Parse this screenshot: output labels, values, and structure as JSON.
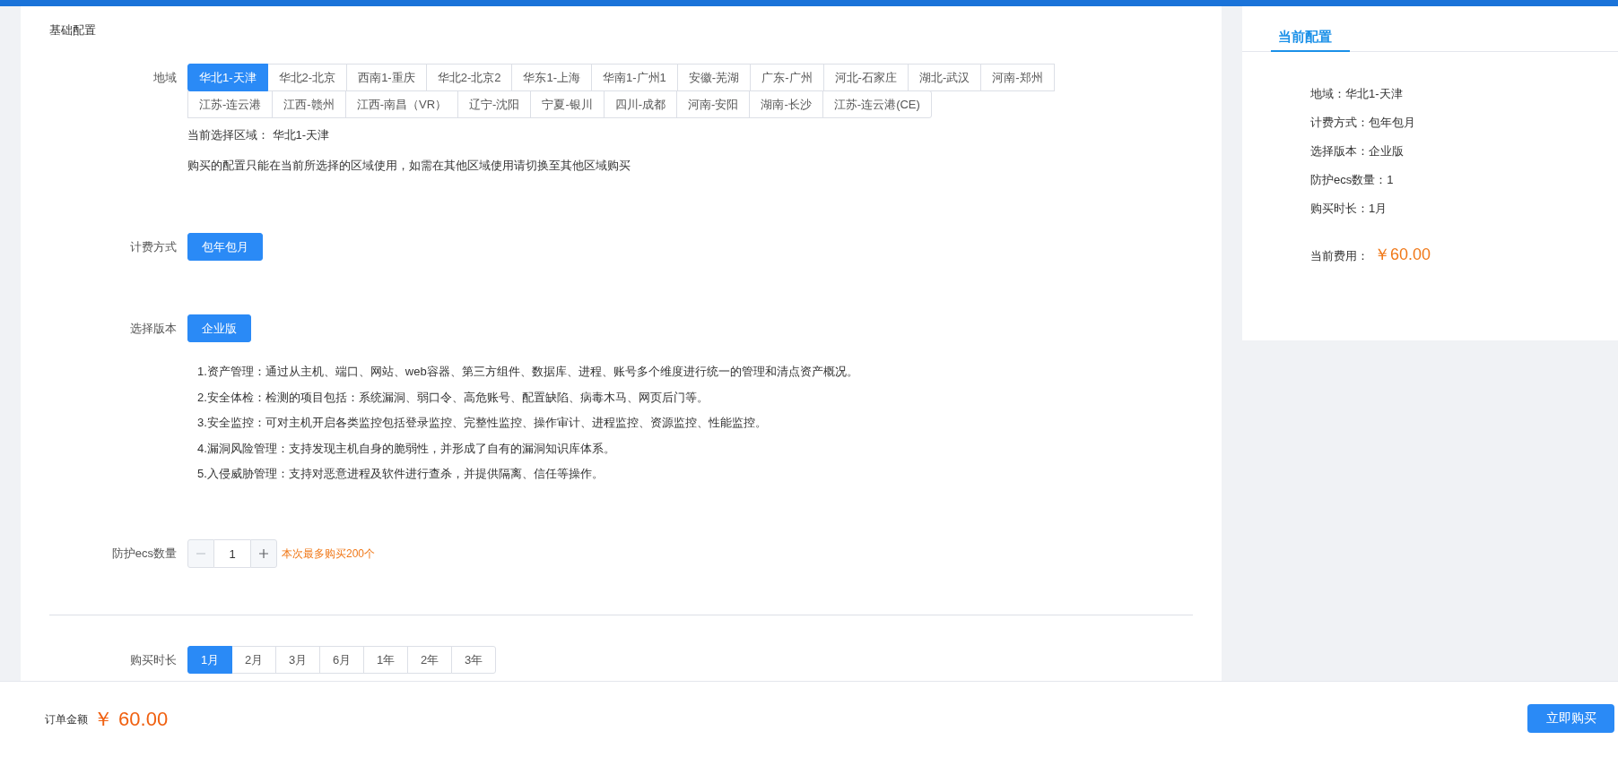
{
  "page_title": "基础配置",
  "region": {
    "label": "地域",
    "rows": [
      [
        {
          "label": "华北1-天津",
          "selected": true
        },
        {
          "label": "华北2-北京",
          "selected": false
        },
        {
          "label": "西南1-重庆",
          "selected": false
        },
        {
          "label": "华北2-北京2",
          "selected": false
        },
        {
          "label": "华东1-上海",
          "selected": false
        },
        {
          "label": "华南1-广州1",
          "selected": false
        },
        {
          "label": "安徽-芜湖",
          "selected": false
        },
        {
          "label": "广东-广州",
          "selected": false
        },
        {
          "label": "河北-石家庄",
          "selected": false
        },
        {
          "label": "湖北-武汉",
          "selected": false
        },
        {
          "label": "河南-郑州",
          "selected": false
        }
      ],
      [
        {
          "label": "江苏-连云港",
          "selected": false
        },
        {
          "label": "江西-赣州",
          "selected": false
        },
        {
          "label": "江西-南昌（VR）",
          "selected": false
        },
        {
          "label": "辽宁-沈阳",
          "selected": false
        },
        {
          "label": "宁夏-银川",
          "selected": false
        },
        {
          "label": "四川-成都",
          "selected": false
        },
        {
          "label": "河南-安阳",
          "selected": false
        },
        {
          "label": "湖南-长沙",
          "selected": false
        },
        {
          "label": "江苏-连云港(CE)",
          "selected": false
        }
      ]
    ],
    "current_label": "当前选择区域：",
    "current_value": "华北1-天津",
    "note": "购买的配置只能在当前所选择的区域使用，如需在其他区域使用请切换至其他区域购买"
  },
  "billing": {
    "label": "计费方式",
    "options": [
      {
        "label": "包年包月",
        "selected": true
      }
    ]
  },
  "edition": {
    "label": "选择版本",
    "options": [
      {
        "label": "企业版",
        "selected": true
      }
    ],
    "features": [
      "1.资产管理：通过从主机、端口、网站、web容器、第三方组件、数据库、进程、账号多个维度进行统一的管理和清点资产概况。",
      "2.安全体检：检测的项目包括：系统漏洞、弱口令、高危账号、配置缺陷、病毒木马、网页后门等。",
      "3.安全监控：可对主机开启各类监控包括登录监控、完整性监控、操作审计、进程监控、资源监控、性能监控。",
      "4.漏洞风险管理：支持发现主机自身的脆弱性，并形成了自有的漏洞知识库体系。",
      "5.入侵威胁管理：支持对恶意进程及软件进行查杀，并提供隔离、信任等操作。"
    ]
  },
  "quantity": {
    "label": "防护ecs数量",
    "value": "1",
    "minus_disabled": true,
    "plus_disabled": false,
    "hint": "本次最多购买200个"
  },
  "duration": {
    "label": "购买时长",
    "options": [
      {
        "label": "1月",
        "selected": true
      },
      {
        "label": "2月",
        "selected": false
      },
      {
        "label": "3月",
        "selected": false
      },
      {
        "label": "6月",
        "selected": false
      },
      {
        "label": "1年",
        "selected": false
      },
      {
        "label": "2年",
        "selected": false
      },
      {
        "label": "3年",
        "selected": false
      }
    ]
  },
  "summary": {
    "title": "当前配置",
    "items": [
      "地域：华北1-天津",
      "计费方式：包年包月",
      "选择版本：企业版",
      "防护ecs数量：1",
      "购买时长：1月"
    ],
    "cost_label": "当前费用：",
    "cost": "￥60.00"
  },
  "footer": {
    "total_label": "订单金额",
    "total": "￥ 60.00",
    "buy_button": "立即购买"
  }
}
